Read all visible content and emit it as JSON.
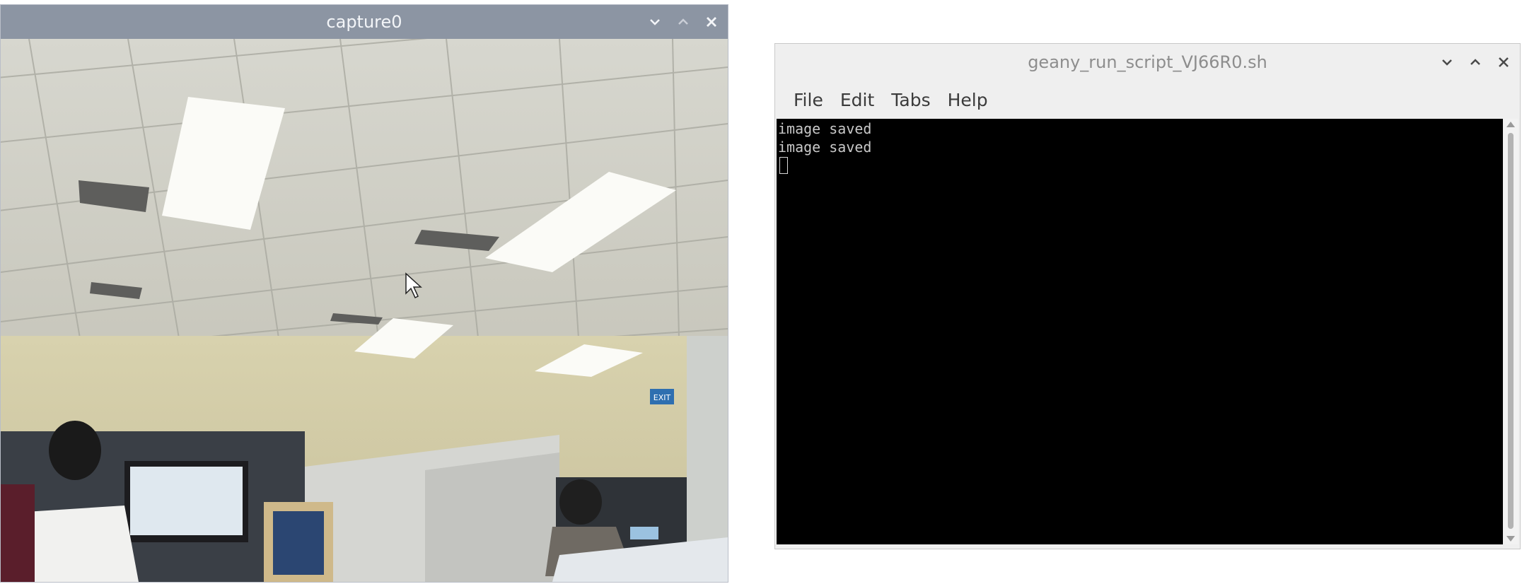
{
  "capture_window": {
    "title": "capture0"
  },
  "terminal_window": {
    "title": "geany_run_script_VJ66R0.sh",
    "menu": [
      "File",
      "Edit",
      "Tabs",
      "Help"
    ],
    "output_lines": [
      "image saved",
      "image saved"
    ]
  },
  "camera_scene": {
    "exit_sign": "EXIT"
  },
  "icons": {
    "minimize": "chevron-down-icon",
    "maximize": "chevron-up-icon",
    "close": "close-icon"
  },
  "colors": {
    "capture_titlebar": "#8c95a3",
    "terminal_background": "#000000",
    "terminal_text": "#c8c8c8"
  }
}
